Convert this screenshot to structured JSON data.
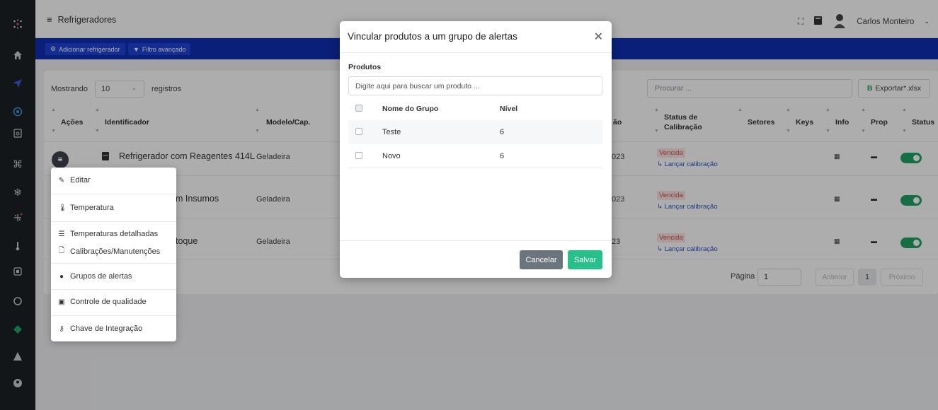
{
  "page": {
    "title": "Refrigeradores",
    "user_name": "Carlos Monteiro"
  },
  "actionbar": {
    "add_label": "Adicionar refrigerador",
    "filter_label": "Filtro avançado"
  },
  "table_controls": {
    "showing_label": "Mostrando",
    "page_size": "10",
    "records_label": "registros",
    "search_placeholder": "Procurar ...",
    "export_label": "Exportar*.xlsx"
  },
  "table": {
    "headers": {
      "acoes": "Ações",
      "identificador": "Identificador",
      "modelo": "Modelo/Cap.",
      "col_partial": "ão",
      "status_calibracao_1": "Status de",
      "status_calibracao_2": "Calibração",
      "setores": "Setores",
      "keys": "Keys",
      "info": "Info",
      "prop": "Prop",
      "status": "Status"
    },
    "rows": [
      {
        "identificador": "Refrigerador com Reagentes 414L",
        "modelo": "Geladeira",
        "date_partial": "023",
        "calib_status": "Vencida",
        "calib_link": "Lançar calibração",
        "active": true
      },
      {
        "identificador": "m Insumos",
        "modelo": "Geladeira",
        "date_partial": "023",
        "calib_status": "Vencida",
        "calib_link": "Lançar calibração",
        "active": true
      },
      {
        "identificador": "toque",
        "modelo": "Geladeira",
        "date_partial": "23",
        "calib_status": "Vencida",
        "calib_link": "Lançar calibração",
        "active": true
      }
    ]
  },
  "pagination": {
    "label": "Página",
    "current_input": "1",
    "prev": "Anterior",
    "current": "1",
    "next": "Próximo"
  },
  "actions_menu": {
    "items": [
      "Editar",
      "Temperatura",
      "Temperaturas detalhadas",
      "Calibrações/Manutenções",
      "Grupos de alertas",
      "Controle de qualidade",
      "Chave de Integração"
    ]
  },
  "modal": {
    "title": "Vincular produtos a um grupo de alertas",
    "products_label": "Produtos",
    "products_placeholder": "Digite aqui para buscar um produto ...",
    "col_group": "Nome do Grupo",
    "col_level": "Nível",
    "rows": [
      {
        "name": "Teste",
        "level": "6"
      },
      {
        "name": "Novo",
        "level": "6"
      }
    ],
    "cancel_label": "Cancelar",
    "save_label": "Salvar"
  }
}
